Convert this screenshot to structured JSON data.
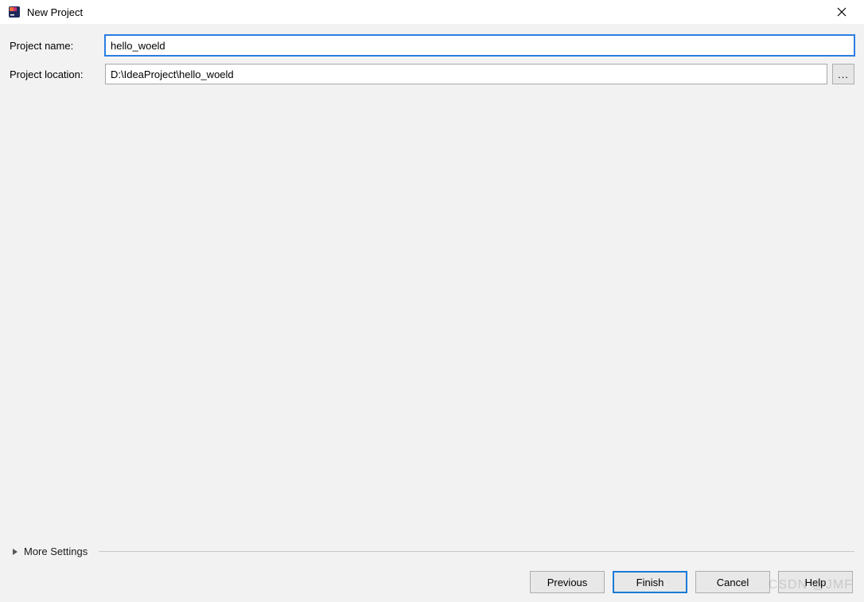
{
  "window": {
    "title": "New Project"
  },
  "form": {
    "project_name_label": "Project name:",
    "project_name_value": "hello_woeld",
    "project_location_label": "Project location:",
    "project_location_value": "D:\\IdeaProject\\hello_woeld",
    "browse_label": "..."
  },
  "more_settings": {
    "label": "More Settings"
  },
  "buttons": {
    "previous": "Previous",
    "finish": "Finish",
    "cancel": "Cancel",
    "help": "Help"
  },
  "watermark": "CSDN @JMF"
}
